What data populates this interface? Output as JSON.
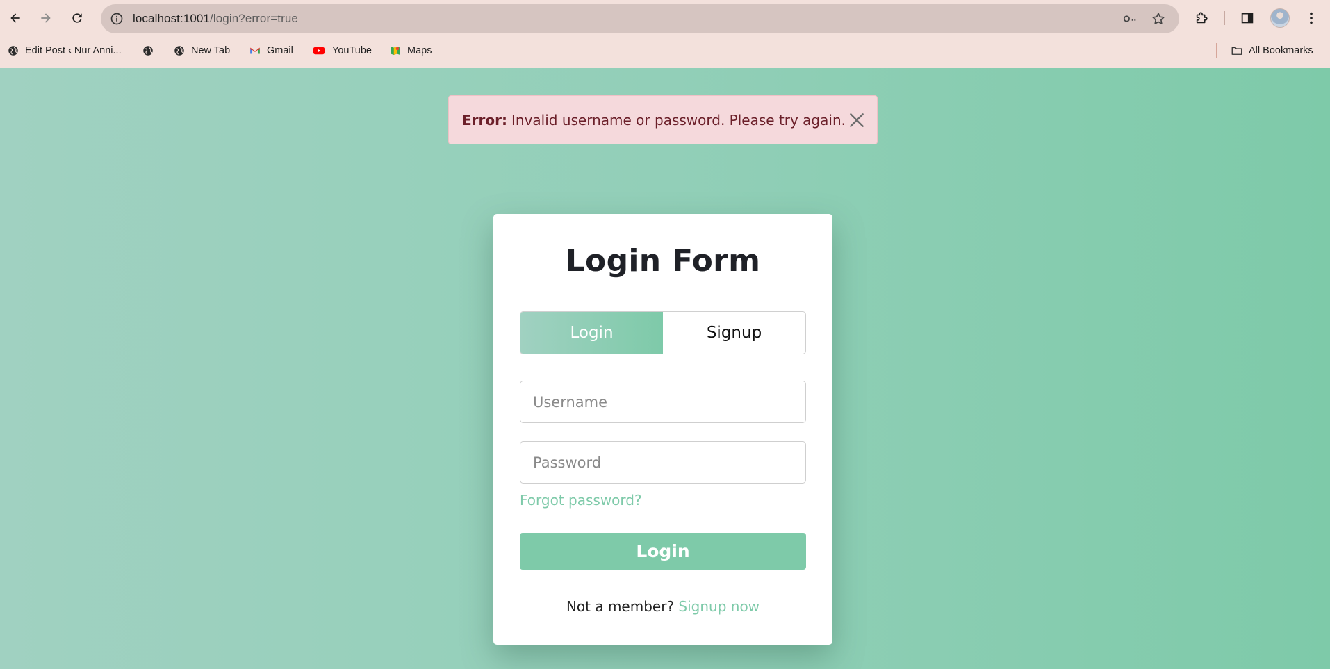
{
  "browser": {
    "url_host": "localhost:1001",
    "url_path": "/login?error=true",
    "bookmarks": [
      {
        "label": "Edit Post ‹ Nur Anni...",
        "icon": "globe-icon"
      },
      {
        "label": "",
        "icon": "globe-icon"
      },
      {
        "label": "New Tab",
        "icon": "globe-icon"
      },
      {
        "label": "Gmail",
        "icon": "gmail-icon"
      },
      {
        "label": "YouTube",
        "icon": "youtube-icon"
      },
      {
        "label": "Maps",
        "icon": "maps-icon"
      }
    ],
    "all_bookmarks_label": "All Bookmarks"
  },
  "alert": {
    "prefix": "Error:",
    "message": "Invalid username or password. Please try again."
  },
  "form": {
    "title": "Login Form",
    "tabs": [
      {
        "label": "Login",
        "active": true
      },
      {
        "label": "Signup",
        "active": false
      }
    ],
    "username_placeholder": "Username",
    "password_placeholder": "Password",
    "forgot_label": "Forgot password?",
    "submit_label": "Login",
    "signup_prompt": "Not a member?",
    "signup_link": "Signup now"
  },
  "colors": {
    "accent": "#7ecaa9",
    "gradient_start": "#a0d1c1",
    "alert_bg": "#f5d9dc",
    "alert_text": "#6b1f29",
    "chrome_bg": "#f3e1dc"
  }
}
